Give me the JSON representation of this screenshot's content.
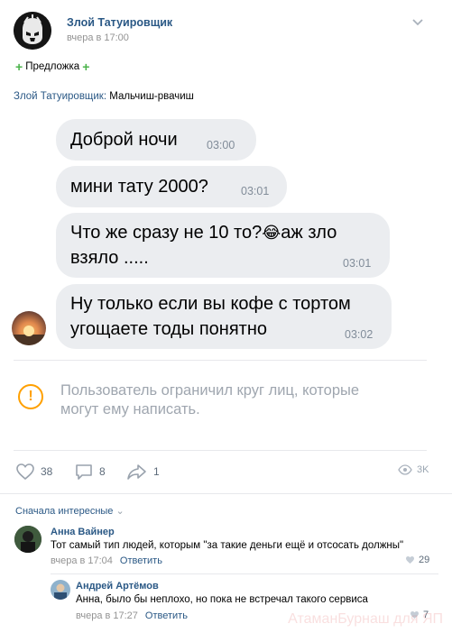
{
  "post": {
    "author": "Злой Татуировщик",
    "time": "вчера в 17:00",
    "suggest_label": "Предложка",
    "caption_author": "Злой Татуировщик:",
    "caption_text": " Мальчиш-рвачиш"
  },
  "messages": [
    {
      "text": "Доброй ночи",
      "time": "03:00"
    },
    {
      "text": "мини тату 2000?",
      "time": "03:01"
    },
    {
      "text_line1": "Что же сразу не 10 то?",
      "emoji": "😂",
      "text_line1_after": "аж зло",
      "text_line2": "взяло .....",
      "time": "03:01"
    },
    {
      "text_line1": "Ну только если вы кофе с тортом",
      "text_line2": "угощаете тоды понятно",
      "time": "03:02"
    }
  ],
  "restriction": {
    "line1": "Пользователь ограничил круг лиц, которые",
    "line2": "могут ему написать."
  },
  "actions": {
    "likes": "38",
    "comments": "8",
    "shares": "1",
    "views": "3K"
  },
  "comments_section": {
    "sort_label": "Сначала интересные"
  },
  "comments": [
    {
      "name": "Анна Вайнер",
      "text": "Тот самый тип людей, которым \"за такие деньги ещё и отсосать должны\"",
      "time": "вчера в 17:04",
      "reply": "Ответить",
      "likes": "29"
    },
    {
      "name": "Андрей Артёмов",
      "text": "Анна, было бы неплохо, но пока не встречал такого сервиса",
      "time": "вчера в 17:27",
      "reply": "Ответить",
      "likes": "7"
    }
  ],
  "watermark": "АтаманБурнаш для ЯП",
  "colors": {
    "link": "#2a5885",
    "bubble": "#ebedf0",
    "warning": "#ffa000",
    "plus": "#4bb34b"
  },
  "icons": [
    "more-chevron-icon",
    "warning-icon",
    "like-icon",
    "comment-icon",
    "share-icon",
    "views-icon"
  ]
}
